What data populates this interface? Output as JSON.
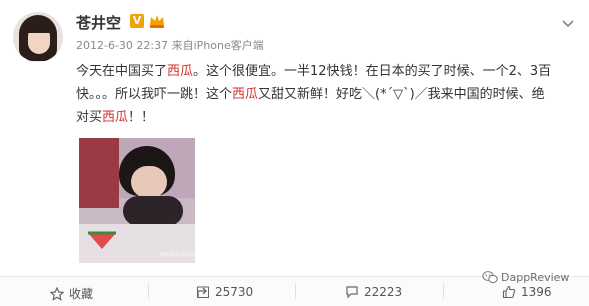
{
  "user": {
    "name": "苍井空",
    "verified_badge": "V"
  },
  "meta": {
    "timestamp": "2012-6-30 22:37",
    "source_prefix": "来自",
    "source": "iPhone客户端"
  },
  "post": {
    "segments": [
      {
        "text": "今天在中国买了",
        "highlight": false
      },
      {
        "text": "西瓜",
        "highlight": true
      },
      {
        "text": "。这个很便宜。一半12快钱！在日本的买了时候、一个2、3百快。。。所以我吓一跳！这个",
        "highlight": false
      },
      {
        "text": "西瓜",
        "highlight": true
      },
      {
        "text": "又甜又新鲜！好吃＼(*´▽`)／我来中国的时候、绝对买",
        "highlight": false
      },
      {
        "text": "西瓜",
        "highlight": true
      },
      {
        "text": "！！",
        "highlight": false
      }
    ]
  },
  "photo": {
    "subject": "girl-eating-watermelon",
    "watermark": "weibo.com"
  },
  "actions": {
    "favorite_label": "收藏",
    "repost_count": "25730",
    "comment_count": "22223",
    "like_count": "1396"
  },
  "watermark": {
    "brand": "DappReview"
  },
  "colors": {
    "highlight": "#d4312c",
    "badge": "#f3a100",
    "text": "#333333",
    "meta": "#8a8a8a"
  }
}
